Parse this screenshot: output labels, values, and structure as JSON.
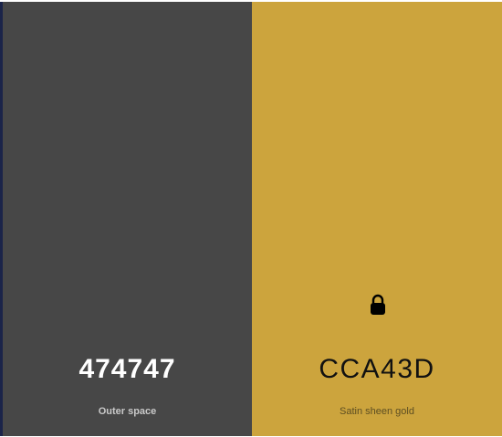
{
  "swatches": [
    {
      "hex": "474747",
      "name": "Outer space",
      "color": "#474747",
      "locked": false
    },
    {
      "hex": "CCA43D",
      "name": "Satin sheen gold",
      "color": "#CCA43D",
      "locked": true,
      "icon": "lock-icon"
    }
  ]
}
